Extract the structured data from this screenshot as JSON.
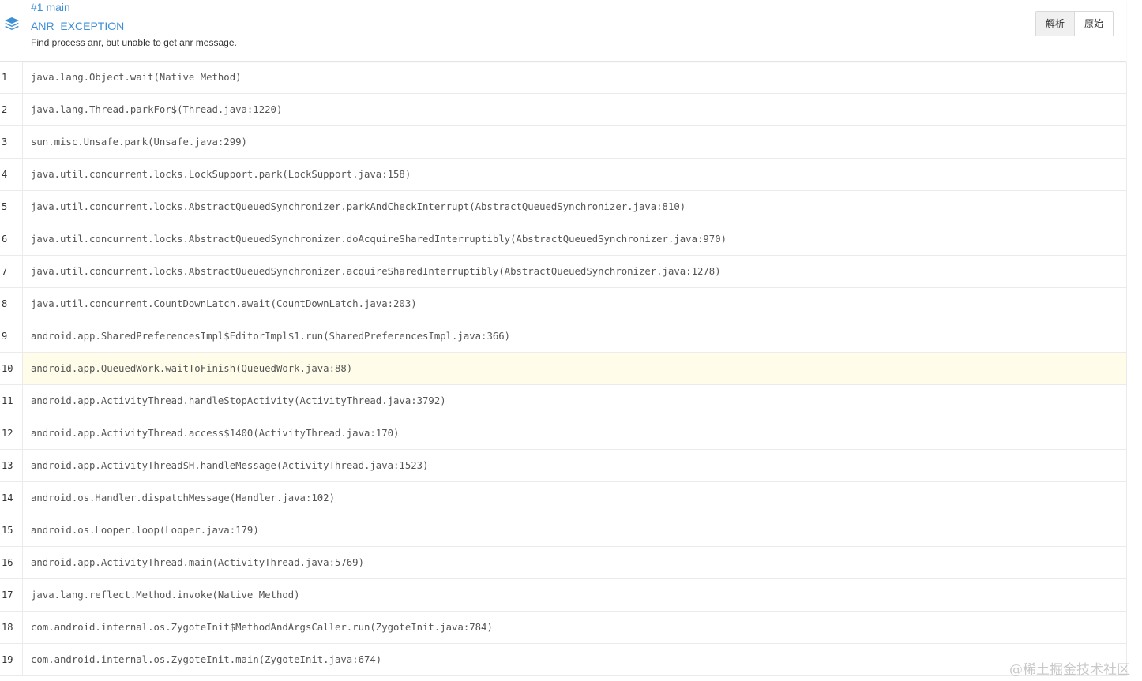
{
  "header": {
    "thread": "#1 main",
    "exception_type": "ANR_EXCEPTION",
    "message": "Find process anr, but unable to get anr message.",
    "icon": "layers-icon",
    "accent_color": "#3e8fd6",
    "buttons": {
      "parse_label": "解析",
      "raw_label": "原始",
      "active": "parse"
    }
  },
  "stack_trace": {
    "highlighted_line": 10,
    "highlight_color": "#fffde9",
    "frames": [
      {
        "line": "1",
        "text": "java.lang.Object.wait(Native Method)"
      },
      {
        "line": "2",
        "text": "java.lang.Thread.parkFor$(Thread.java:1220)"
      },
      {
        "line": "3",
        "text": "sun.misc.Unsafe.park(Unsafe.java:299)"
      },
      {
        "line": "4",
        "text": "java.util.concurrent.locks.LockSupport.park(LockSupport.java:158)"
      },
      {
        "line": "5",
        "text": "java.util.concurrent.locks.AbstractQueuedSynchronizer.parkAndCheckInterrupt(AbstractQueuedSynchronizer.java:810)"
      },
      {
        "line": "6",
        "text": "java.util.concurrent.locks.AbstractQueuedSynchronizer.doAcquireSharedInterruptibly(AbstractQueuedSynchronizer.java:970)"
      },
      {
        "line": "7",
        "text": "java.util.concurrent.locks.AbstractQueuedSynchronizer.acquireSharedInterruptibly(AbstractQueuedSynchronizer.java:1278)"
      },
      {
        "line": "8",
        "text": "java.util.concurrent.CountDownLatch.await(CountDownLatch.java:203)"
      },
      {
        "line": "9",
        "text": "android.app.SharedPreferencesImpl$EditorImpl$1.run(SharedPreferencesImpl.java:366)"
      },
      {
        "line": "10",
        "text": "android.app.QueuedWork.waitToFinish(QueuedWork.java:88)"
      },
      {
        "line": "11",
        "text": "android.app.ActivityThread.handleStopActivity(ActivityThread.java:3792)"
      },
      {
        "line": "12",
        "text": "android.app.ActivityThread.access$1400(ActivityThread.java:170)"
      },
      {
        "line": "13",
        "text": "android.app.ActivityThread$H.handleMessage(ActivityThread.java:1523)"
      },
      {
        "line": "14",
        "text": "android.os.Handler.dispatchMessage(Handler.java:102)"
      },
      {
        "line": "15",
        "text": "android.os.Looper.loop(Looper.java:179)"
      },
      {
        "line": "16",
        "text": "android.app.ActivityThread.main(ActivityThread.java:5769)"
      },
      {
        "line": "17",
        "text": "java.lang.reflect.Method.invoke(Native Method)"
      },
      {
        "line": "18",
        "text": "com.android.internal.os.ZygoteInit$MethodAndArgsCaller.run(ZygoteInit.java:784)"
      },
      {
        "line": "19",
        "text": "com.android.internal.os.ZygoteInit.main(ZygoteInit.java:674)"
      }
    ]
  },
  "watermark": "@稀土掘金技术社区"
}
